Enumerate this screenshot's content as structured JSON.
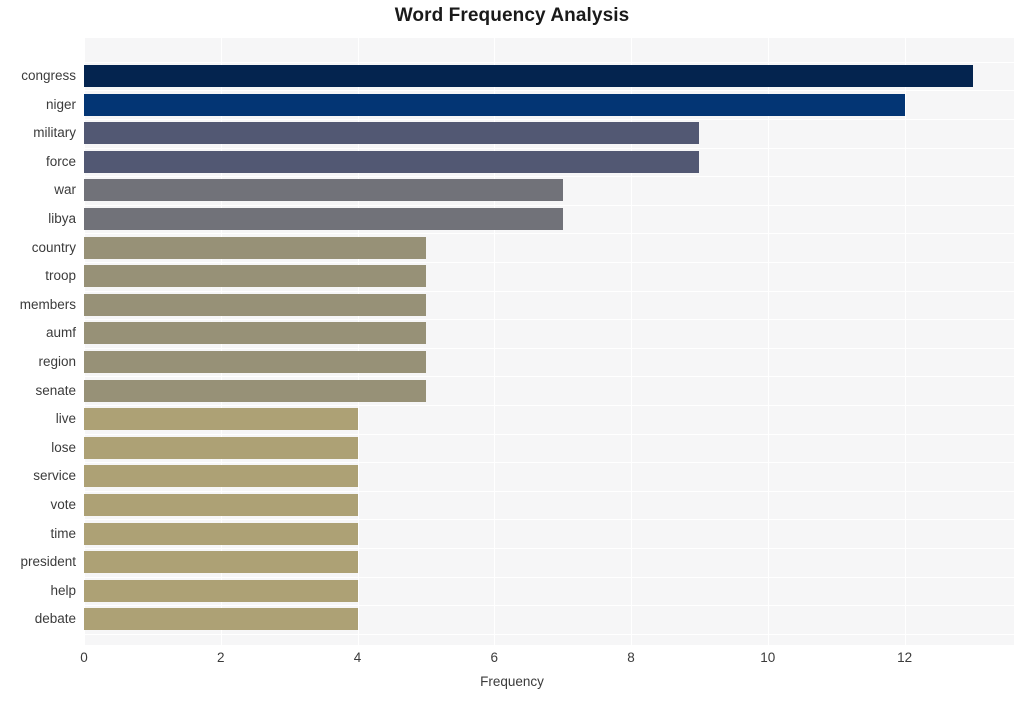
{
  "chart_data": {
    "type": "bar",
    "orientation": "horizontal",
    "title": "Word Frequency Analysis",
    "xlabel": "Frequency",
    "ylabel": "",
    "categories": [
      "congress",
      "niger",
      "military",
      "force",
      "war",
      "libya",
      "country",
      "troop",
      "members",
      "aumf",
      "region",
      "senate",
      "live",
      "lose",
      "service",
      "vote",
      "time",
      "president",
      "help",
      "debate"
    ],
    "values": [
      13,
      12,
      9,
      9,
      7,
      7,
      5,
      5,
      5,
      5,
      5,
      5,
      4,
      4,
      4,
      4,
      4,
      4,
      4,
      4
    ],
    "bar_colors": [
      "#04244f",
      "#033574",
      "#525873",
      "#525873",
      "#717279",
      "#717279",
      "#979177",
      "#979177",
      "#979177",
      "#979177",
      "#979177",
      "#979177",
      "#ada175",
      "#ada175",
      "#ada175",
      "#ada175",
      "#ada175",
      "#ada175",
      "#ada175",
      "#ada175"
    ],
    "xticks": [
      0,
      2,
      4,
      6,
      8,
      10,
      12
    ],
    "xticklabels": [
      "0",
      "2",
      "4",
      "6",
      "8",
      "10",
      "12"
    ],
    "xlim": [
      0,
      13.6
    ],
    "grid": true,
    "legend": false,
    "plot_background": "#f6f6f7",
    "figure_background": "#ffffff",
    "gridline_color": "#ffffff",
    "text_color": "#3b3b3b",
    "title_color": "#1a1a1a"
  }
}
